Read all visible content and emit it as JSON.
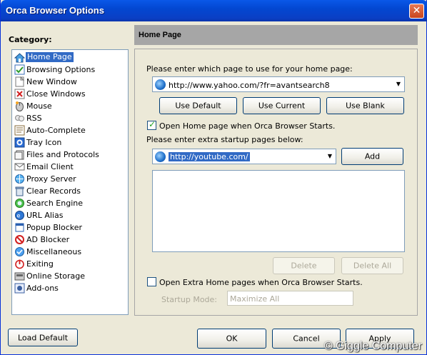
{
  "window": {
    "title": "Orca Browser Options",
    "close": "✕"
  },
  "sidebar": {
    "label": "Category:",
    "items": [
      {
        "label": "Home Page",
        "icon": "house-icon"
      },
      {
        "label": "Browsing Options",
        "icon": "browse-icon"
      },
      {
        "label": "New Window",
        "icon": "new-window-icon"
      },
      {
        "label": "Close Windows",
        "icon": "close-window-icon"
      },
      {
        "label": "Mouse",
        "icon": "mouse-icon"
      },
      {
        "label": "RSS",
        "icon": "rss-icon"
      },
      {
        "label": "Auto-Complete",
        "icon": "auto-complete-icon"
      },
      {
        "label": "Tray Icon",
        "icon": "tray-icon"
      },
      {
        "label": "Files and Protocols",
        "icon": "files-icon"
      },
      {
        "label": "Email Client",
        "icon": "email-icon"
      },
      {
        "label": "Proxy Server",
        "icon": "proxy-icon"
      },
      {
        "label": "Clear Records",
        "icon": "trash-icon"
      },
      {
        "label": "Search Engine",
        "icon": "search-icon"
      },
      {
        "label": "URL Alias",
        "icon": "url-alias-icon"
      },
      {
        "label": "Popup Blocker",
        "icon": "popup-icon"
      },
      {
        "label": "AD Blocker",
        "icon": "ad-block-icon"
      },
      {
        "label": "Miscellaneous",
        "icon": "misc-icon"
      },
      {
        "label": "Exiting",
        "icon": "exit-icon"
      },
      {
        "label": "Online Storage",
        "icon": "storage-icon"
      },
      {
        "label": "Add-ons",
        "icon": "addons-icon"
      }
    ]
  },
  "panel": {
    "header": "Home Page",
    "prompt_home": "Please enter which page to use for your home page:",
    "home_url": "http://www.yahoo.com/?fr=avantsearch8",
    "use_default": "Use Default",
    "use_current": "Use Current",
    "use_blank": "Use Blank",
    "open_home_label": "Open Home page when Orca Browser Starts.",
    "prompt_extra": "Please enter extra startup pages below:",
    "extra_url": "http://youtube.com/",
    "add": "Add",
    "delete": "Delete",
    "delete_all": "Delete All",
    "open_extra_label": "Open Extra Home pages when Orca Browser Starts.",
    "startup_mode_label": "Startup Mode:",
    "startup_mode_value": "Maximize All"
  },
  "footer": {
    "load_default": "Load Default",
    "ok": "OK",
    "cancel": "Cancel",
    "apply": "Apply"
  },
  "watermark": "© Giggle Computer"
}
